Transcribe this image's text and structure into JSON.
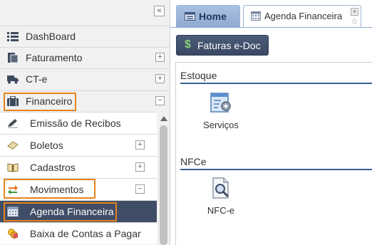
{
  "sidebar": {
    "collapse_glyph": "«",
    "items": [
      {
        "label": "DashBoard",
        "icon": "list-icon"
      },
      {
        "label": "Faturamento",
        "icon": "document-icon",
        "toggle": "+"
      },
      {
        "label": "CT-e",
        "icon": "truck-icon",
        "toggle": "+"
      },
      {
        "label": "Financeiro",
        "icon": "briefcase-icon",
        "toggle": "−"
      }
    ],
    "financeiro_children": [
      {
        "label": "Emissão de Recibos",
        "icon": "pen-icon"
      },
      {
        "label": "Boletos",
        "icon": "eraser-icon",
        "toggle": "+"
      },
      {
        "label": "Cadastros",
        "icon": "book-icon",
        "toggle": "+"
      },
      {
        "label": "Movimentos",
        "icon": "arrows-icon",
        "toggle": "−"
      },
      {
        "label": "Agenda Financeira",
        "icon": "calendar-icon"
      },
      {
        "label": "Baixa de Contas a Pagar",
        "icon": "coins-icon"
      }
    ]
  },
  "tabs": {
    "home": {
      "label": "Home",
      "icon": "home-icon"
    },
    "agenda": {
      "label": "Agenda Financeira",
      "icon": "calendar-icon",
      "close": "×",
      "pin": "☆"
    }
  },
  "main": {
    "faturas_button": {
      "label": "Faturas e-Doc",
      "icon": "$"
    },
    "sections": [
      {
        "title": "Estoque",
        "tiles": [
          {
            "label": "Serviços",
            "icon": "services-icon"
          }
        ]
      },
      {
        "title": "NFCe",
        "tiles": [
          {
            "label": "NFC-e",
            "icon": "nfce-search-icon"
          }
        ]
      }
    ]
  },
  "colors": {
    "highlight": "#e8821d",
    "active_row": "#3f4d66",
    "button": "#3f4d66",
    "section_rule": "#3b5f98"
  }
}
